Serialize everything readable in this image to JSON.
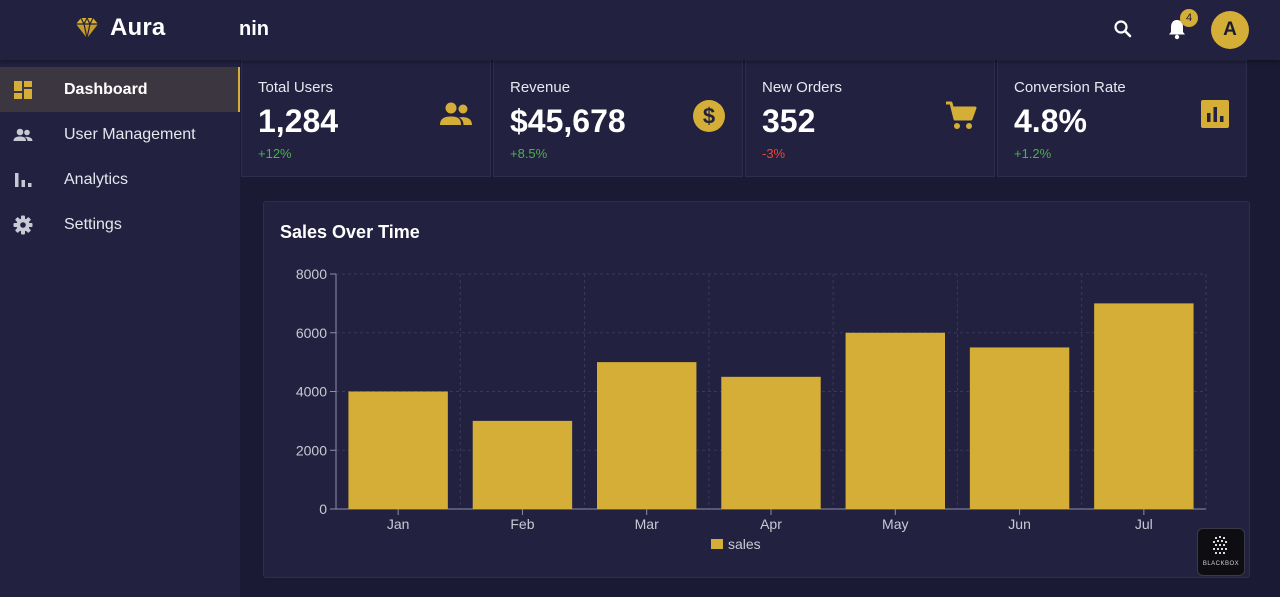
{
  "app": {
    "name": "Aura",
    "header_title": "nin"
  },
  "header": {
    "notification_count": "4",
    "avatar_initial": "A"
  },
  "sidebar": {
    "items": [
      {
        "label": "Dashboard",
        "icon": "dashboard-icon",
        "active": true
      },
      {
        "label": "User Management",
        "icon": "people-icon",
        "active": false
      },
      {
        "label": "Analytics",
        "icon": "bar-chart-icon",
        "active": false
      },
      {
        "label": "Settings",
        "icon": "gear-icon",
        "active": false
      }
    ]
  },
  "cards": [
    {
      "title": "Total Users",
      "value": "1,284",
      "change": "+12%",
      "trend": "up",
      "icon": "people-icon"
    },
    {
      "title": "Revenue",
      "value": "$45,678",
      "change": "+8.5%",
      "trend": "up",
      "icon": "dollar-icon"
    },
    {
      "title": "New Orders",
      "value": "352",
      "change": "-3%",
      "trend": "down",
      "icon": "cart-icon"
    },
    {
      "title": "Conversion Rate",
      "value": "4.8%",
      "change": "+1.2%",
      "trend": "up",
      "icon": "bar-chart-icon"
    }
  ],
  "colors": {
    "accent": "#d4ae37",
    "positive": "#4caf50",
    "negative": "#f44336",
    "background": "#1b1a34",
    "panel": "#22213f"
  },
  "watermark": {
    "text": "BLACKBOX"
  },
  "chart_data": {
    "type": "bar",
    "title": "Sales Over Time",
    "categories": [
      "Jan",
      "Feb",
      "Mar",
      "Apr",
      "May",
      "Jun",
      "Jul"
    ],
    "series": [
      {
        "name": "sales",
        "values": [
          4000,
          3000,
          5000,
          4500,
          6000,
          5500,
          7000
        ]
      }
    ],
    "ylim": [
      0,
      8000
    ],
    "yticks": [
      0,
      2000,
      4000,
      6000,
      8000
    ],
    "xlabel": "",
    "ylabel": "",
    "grid": true,
    "legend": "bottom-center"
  }
}
